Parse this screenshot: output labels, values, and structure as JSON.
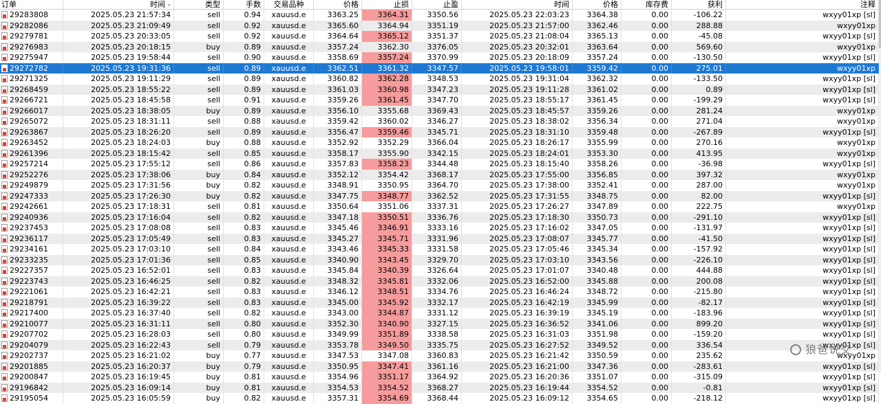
{
  "columns": [
    "订单",
    "时间",
    "类型",
    "手数",
    "交易品种",
    "价格",
    "止损",
    "止盈",
    "时间",
    "价格",
    "库存费",
    "获利",
    "注释"
  ],
  "sort_icon": "sort-desc-icon",
  "colors": {
    "selected_row": "#1e78d2",
    "stop_loss_highlight": "#f69c9c",
    "alt_row": "#ececec"
  },
  "watermark": "狼爸说交",
  "rows": [
    {
      "order": "29283808",
      "open_time": "2025.05.23 21:57:34",
      "type": "sell",
      "volume": "0.94",
      "symbol": "xauusd.e",
      "open_price": "3363.25",
      "sl": "3364.31",
      "tp": "3350.56",
      "close_time": "2025.05.23 22:03:23",
      "close_price": "3364.38",
      "swap": "0.00",
      "profit": "-106.22",
      "comment": "wxyy01xp [sl]",
      "sl_hit": true
    },
    {
      "order": "29282086",
      "open_time": "2025.05.23 21:09:49",
      "type": "sell",
      "volume": "0.92",
      "symbol": "xauusd.e",
      "open_price": "3365.60",
      "sl": "3364.94",
      "tp": "3351.19",
      "close_time": "2025.05.23 21:57:00",
      "close_price": "3362.46",
      "swap": "0.00",
      "profit": "288.88",
      "comment": "wxyy01xp",
      "sl_hit": false
    },
    {
      "order": "29279781",
      "open_time": "2025.05.23 20:33:05",
      "type": "sell",
      "volume": "0.92",
      "symbol": "xauusd.e",
      "open_price": "3364.64",
      "sl": "3365.12",
      "tp": "3351.37",
      "close_time": "2025.05.23 21:08:04",
      "close_price": "3365.13",
      "swap": "0.00",
      "profit": "-45.08",
      "comment": "wxyy01xp [sl]",
      "sl_hit": true
    },
    {
      "order": "29276983",
      "open_time": "2025.05.23 20:18:15",
      "type": "buy",
      "volume": "0.89",
      "symbol": "xauusd.e",
      "open_price": "3357.24",
      "sl": "3362.30",
      "tp": "3376.05",
      "close_time": "2025.05.23 20:32:01",
      "close_price": "3363.64",
      "swap": "0.00",
      "profit": "569.60",
      "comment": "wxyy01xp",
      "sl_hit": false
    },
    {
      "order": "29275947",
      "open_time": "2025.05.23 19:58:44",
      "type": "sell",
      "volume": "0.90",
      "symbol": "xauusd.e",
      "open_price": "3358.69",
      "sl": "3357.24",
      "tp": "3370.99",
      "close_time": "2025.05.23 20:18:09",
      "close_price": "3357.24",
      "swap": "0.00",
      "profit": "-130.50",
      "comment": "wxyy01xp [sl]",
      "sl_hit": true
    },
    {
      "order": "29272782",
      "open_time": "2025.05.23 19:31:36",
      "type": "sell",
      "volume": "0.89",
      "symbol": "xauusd.e",
      "open_price": "3362.51",
      "sl": "3361.32",
      "tp": "3347.57",
      "close_time": "2025.05.23 19:58:01",
      "close_price": "3359.42",
      "swap": "0.00",
      "profit": "275.01",
      "comment": "wxyy01xp",
      "sl_hit": false,
      "selected": true
    },
    {
      "order": "29271325",
      "open_time": "2025.05.23 19:11:29",
      "type": "sell",
      "volume": "0.89",
      "symbol": "xauusd.e",
      "open_price": "3360.82",
      "sl": "3362.28",
      "tp": "3348.53",
      "close_time": "2025.05.23 19:31:04",
      "close_price": "3362.32",
      "swap": "0.00",
      "profit": "-133.50",
      "comment": "wxyy01xp [sl]",
      "sl_hit": true
    },
    {
      "order": "29268459",
      "open_time": "2025.05.23 18:55:22",
      "type": "sell",
      "volume": "0.89",
      "symbol": "xauusd.e",
      "open_price": "3361.03",
      "sl": "3360.98",
      "tp": "3347.23",
      "close_time": "2025.05.23 19:11:28",
      "close_price": "3361.02",
      "swap": "0.00",
      "profit": "0.89",
      "comment": "wxyy01xp [sl]",
      "sl_hit": true
    },
    {
      "order": "29266721",
      "open_time": "2025.05.23 18:45:58",
      "type": "sell",
      "volume": "0.91",
      "symbol": "xauusd.e",
      "open_price": "3359.26",
      "sl": "3361.45",
      "tp": "3347.70",
      "close_time": "2025.05.23 18:55:17",
      "close_price": "3361.45",
      "swap": "0.00",
      "profit": "-199.29",
      "comment": "wxyy01xp [sl]",
      "sl_hit": true
    },
    {
      "order": "29266017",
      "open_time": "2025.05.23 18:38:05",
      "type": "buy",
      "volume": "0.89",
      "symbol": "xauusd.e",
      "open_price": "3356.10",
      "sl": "3355.68",
      "tp": "3369.43",
      "close_time": "2025.05.23 18:45:57",
      "close_price": "3359.26",
      "swap": "0.00",
      "profit": "281.24",
      "comment": "wxyy01xp",
      "sl_hit": false
    },
    {
      "order": "29265072",
      "open_time": "2025.05.23 18:31:11",
      "type": "sell",
      "volume": "0.88",
      "symbol": "xauusd.e",
      "open_price": "3359.42",
      "sl": "3360.02",
      "tp": "3346.27",
      "close_time": "2025.05.23 18:38:02",
      "close_price": "3356.34",
      "swap": "0.00",
      "profit": "271.04",
      "comment": "wxyy01xp",
      "sl_hit": false
    },
    {
      "order": "29263867",
      "open_time": "2025.05.23 18:26:20",
      "type": "sell",
      "volume": "0.89",
      "symbol": "xauusd.e",
      "open_price": "3356.47",
      "sl": "3359.46",
      "tp": "3345.71",
      "close_time": "2025.05.23 18:31:10",
      "close_price": "3359.48",
      "swap": "0.00",
      "profit": "-267.89",
      "comment": "wxyy01xp [sl]",
      "sl_hit": true
    },
    {
      "order": "29263452",
      "open_time": "2025.05.23 18:24:03",
      "type": "buy",
      "volume": "0.88",
      "symbol": "xauusd.e",
      "open_price": "3352.92",
      "sl": "3352.29",
      "tp": "3366.04",
      "close_time": "2025.05.23 18:26:17",
      "close_price": "3355.99",
      "swap": "0.00",
      "profit": "270.16",
      "comment": "wxyy01xp",
      "sl_hit": false
    },
    {
      "order": "29261396",
      "open_time": "2025.05.23 18:15:42",
      "type": "sell",
      "volume": "0.85",
      "symbol": "xauusd.e",
      "open_price": "3358.17",
      "sl": "3355.90",
      "tp": "3342.15",
      "close_time": "2025.05.23 18:24:01",
      "close_price": "3353.30",
      "swap": "0.00",
      "profit": "413.95",
      "comment": "wxyy01xp",
      "sl_hit": false
    },
    {
      "order": "29257214",
      "open_time": "2025.05.23 17:55:12",
      "type": "sell",
      "volume": "0.86",
      "symbol": "xauusd.e",
      "open_price": "3357.83",
      "sl": "3358.23",
      "tp": "3344.48",
      "close_time": "2025.05.23 18:15:40",
      "close_price": "3358.26",
      "swap": "0.00",
      "profit": "-36.98",
      "comment": "wxyy01xp [sl]",
      "sl_hit": true
    },
    {
      "order": "29252276",
      "open_time": "2025.05.23 17:38:06",
      "type": "buy",
      "volume": "0.84",
      "symbol": "xauusd.e",
      "open_price": "3352.12",
      "sl": "3354.42",
      "tp": "3368.17",
      "close_time": "2025.05.23 17:55:00",
      "close_price": "3356.85",
      "swap": "0.00",
      "profit": "397.32",
      "comment": "wxyy01xp",
      "sl_hit": false
    },
    {
      "order": "29249879",
      "open_time": "2025.05.23 17:31:56",
      "type": "buy",
      "volume": "0.82",
      "symbol": "xauusd.e",
      "open_price": "3348.91",
      "sl": "3350.95",
      "tp": "3364.70",
      "close_time": "2025.05.23 17:38:00",
      "close_price": "3352.41",
      "swap": "0.00",
      "profit": "287.00",
      "comment": "wxyy01xp",
      "sl_hit": false
    },
    {
      "order": "29247333",
      "open_time": "2025.05.23 17:26:30",
      "type": "buy",
      "volume": "0.82",
      "symbol": "xauusd.e",
      "open_price": "3347.75",
      "sl": "3348.77",
      "tp": "3362.52",
      "close_time": "2025.05.23 17:31:55",
      "close_price": "3348.75",
      "swap": "0.00",
      "profit": "82.00",
      "comment": "wxyy01xp [sl]",
      "sl_hit": true
    },
    {
      "order": "29242661",
      "open_time": "2025.05.23 17:18:31",
      "type": "sell",
      "volume": "0.81",
      "symbol": "xauusd.e",
      "open_price": "3350.64",
      "sl": "3351.06",
      "tp": "3337.31",
      "close_time": "2025.05.23 17:26:27",
      "close_price": "3347.89",
      "swap": "0.00",
      "profit": "222.75",
      "comment": "wxyy01xp",
      "sl_hit": false
    },
    {
      "order": "29240936",
      "open_time": "2025.05.23 17:16:04",
      "type": "sell",
      "volume": "0.82",
      "symbol": "xauusd.e",
      "open_price": "3347.18",
      "sl": "3350.51",
      "tp": "3336.76",
      "close_time": "2025.05.23 17:18:30",
      "close_price": "3350.73",
      "swap": "0.00",
      "profit": "-291.10",
      "comment": "wxyy01xp [sl]",
      "sl_hit": true
    },
    {
      "order": "29237453",
      "open_time": "2025.05.23 17:08:08",
      "type": "sell",
      "volume": "0.83",
      "symbol": "xauusd.e",
      "open_price": "3345.46",
      "sl": "3346.91",
      "tp": "3333.16",
      "close_time": "2025.05.23 17:16:02",
      "close_price": "3347.05",
      "swap": "0.00",
      "profit": "-131.97",
      "comment": "wxyy01xp [sl]",
      "sl_hit": true
    },
    {
      "order": "29236117",
      "open_time": "2025.05.23 17:05:49",
      "type": "sell",
      "volume": "0.83",
      "symbol": "xauusd.e",
      "open_price": "3345.27",
      "sl": "3345.71",
      "tp": "3331.96",
      "close_time": "2025.05.23 17:08:07",
      "close_price": "3345.77",
      "swap": "0.00",
      "profit": "-41.50",
      "comment": "wxyy01xp [sl]",
      "sl_hit": true
    },
    {
      "order": "29234161",
      "open_time": "2025.05.23 17:03:10",
      "type": "sell",
      "volume": "0.84",
      "symbol": "xauusd.e",
      "open_price": "3343.46",
      "sl": "3345.33",
      "tp": "3331.58",
      "close_time": "2025.05.23 17:05:46",
      "close_price": "3345.34",
      "swap": "0.00",
      "profit": "-157.92",
      "comment": "wxyy01xp [sl]",
      "sl_hit": true
    },
    {
      "order": "29233235",
      "open_time": "2025.05.23 17:01:36",
      "type": "sell",
      "volume": "0.85",
      "symbol": "xauusd.e",
      "open_price": "3340.90",
      "sl": "3343.45",
      "tp": "3329.70",
      "close_time": "2025.05.23 17:03:10",
      "close_price": "3343.56",
      "swap": "0.00",
      "profit": "-226.10",
      "comment": "wxyy01xp [sl]",
      "sl_hit": true
    },
    {
      "order": "29227357",
      "open_time": "2025.05.23 16:52:01",
      "type": "sell",
      "volume": "0.83",
      "symbol": "xauusd.e",
      "open_price": "3345.84",
      "sl": "3340.39",
      "tp": "3326.64",
      "close_time": "2025.05.23 17:01:07",
      "close_price": "3340.48",
      "swap": "0.00",
      "profit": "444.88",
      "comment": "wxyy01xp [sl]",
      "sl_hit": true
    },
    {
      "order": "29223743",
      "open_time": "2025.05.23 16:46:25",
      "type": "sell",
      "volume": "0.82",
      "symbol": "xauusd.e",
      "open_price": "3348.32",
      "sl": "3345.81",
      "tp": "3332.06",
      "close_time": "2025.05.23 16:52:00",
      "close_price": "3345.88",
      "swap": "0.00",
      "profit": "200.08",
      "comment": "wxyy01xp [sl]",
      "sl_hit": true
    },
    {
      "order": "29221061",
      "open_time": "2025.05.23 16:42:21",
      "type": "sell",
      "volume": "0.83",
      "symbol": "xauusd.e",
      "open_price": "3346.12",
      "sl": "3348.51",
      "tp": "3334.76",
      "close_time": "2025.05.23 16:46:24",
      "close_price": "3348.72",
      "swap": "0.00",
      "profit": "-215.80",
      "comment": "wxyy01xp [sl]",
      "sl_hit": true
    },
    {
      "order": "29218791",
      "open_time": "2025.05.23 16:39:22",
      "type": "sell",
      "volume": "0.83",
      "symbol": "xauusd.e",
      "open_price": "3345.00",
      "sl": "3345.92",
      "tp": "3332.17",
      "close_time": "2025.05.23 16:42:19",
      "close_price": "3345.99",
      "swap": "0.00",
      "profit": "-82.17",
      "comment": "wxyy01xp [sl]",
      "sl_hit": true
    },
    {
      "order": "29217400",
      "open_time": "2025.05.23 16:37:40",
      "type": "sell",
      "volume": "0.82",
      "symbol": "xauusd.e",
      "open_price": "3343.00",
      "sl": "3344.87",
      "tp": "3331.12",
      "close_time": "2025.05.23 16:39:19",
      "close_price": "3345.19",
      "swap": "0.00",
      "profit": "-183.96",
      "comment": "wxyy01xp [sl]",
      "sl_hit": true
    },
    {
      "order": "29210077",
      "open_time": "2025.05.23 16:31:11",
      "type": "sell",
      "volume": "0.80",
      "symbol": "xauusd.e",
      "open_price": "3352.30",
      "sl": "3340.90",
      "tp": "3327.15",
      "close_time": "2025.05.23 16:36:52",
      "close_price": "3341.06",
      "swap": "0.00",
      "profit": "899.20",
      "comment": "wxyy01xp [sl]",
      "sl_hit": true
    },
    {
      "order": "29207702",
      "open_time": "2025.05.23 16:28:03",
      "type": "sell",
      "volume": "0.80",
      "symbol": "xauusd.e",
      "open_price": "3349.99",
      "sl": "3351.89",
      "tp": "3338.58",
      "close_time": "2025.05.23 16:31:03",
      "close_price": "3351.98",
      "swap": "0.00",
      "profit": "-159.20",
      "comment": "wxyy01xp [sl]",
      "sl_hit": true
    },
    {
      "order": "29204079",
      "open_time": "2025.05.23 16:22:43",
      "type": "sell",
      "volume": "0.79",
      "symbol": "xauusd.e",
      "open_price": "3353.78",
      "sl": "3349.50",
      "tp": "3335.75",
      "close_time": "2025.05.23 16:27:52",
      "close_price": "3349.52",
      "swap": "0.00",
      "profit": "336.54",
      "comment": "wxyy01xp [sl]",
      "sl_hit": true
    },
    {
      "order": "29202737",
      "open_time": "2025.05.23 16:21:02",
      "type": "buy",
      "volume": "0.77",
      "symbol": "xauusd.e",
      "open_price": "3347.53",
      "sl": "3347.08",
      "tp": "3360.83",
      "close_time": "2025.05.23 16:21:42",
      "close_price": "3350.59",
      "swap": "0.00",
      "profit": "235.62",
      "comment": "wxyy01xp",
      "sl_hit": false
    },
    {
      "order": "29201885",
      "open_time": "2025.05.23 16:20:37",
      "type": "buy",
      "volume": "0.79",
      "symbol": "xauusd.e",
      "open_price": "3350.95",
      "sl": "3347.41",
      "tp": "3361.16",
      "close_time": "2025.05.23 16:21:00",
      "close_price": "3347.36",
      "swap": "0.00",
      "profit": "-283.61",
      "comment": "wxyy01xp [sl]",
      "sl_hit": true
    },
    {
      "order": "29200847",
      "open_time": "2025.05.23 16:19:45",
      "type": "buy",
      "volume": "0.81",
      "symbol": "xauusd.e",
      "open_price": "3354.96",
      "sl": "3351.17",
      "tp": "3364.92",
      "close_time": "2025.05.23 16:20:36",
      "close_price": "3351.07",
      "swap": "0.00",
      "profit": "-315.09",
      "comment": "wxyy01xp [sl]",
      "sl_hit": true
    },
    {
      "order": "29196842",
      "open_time": "2025.05.23 16:09:14",
      "type": "buy",
      "volume": "0.81",
      "symbol": "xauusd.e",
      "open_price": "3354.53",
      "sl": "3354.52",
      "tp": "3368.27",
      "close_time": "2025.05.23 16:19:44",
      "close_price": "3354.52",
      "swap": "0.00",
      "profit": "-0.81",
      "comment": "wxyy01xp [sl]",
      "sl_hit": true
    },
    {
      "order": "29195054",
      "open_time": "2025.05.23 16:05:59",
      "type": "buy",
      "volume": "0.82",
      "symbol": "xauusd.e",
      "open_price": "3357.31",
      "sl": "3354.69",
      "tp": "3368.44",
      "close_time": "2025.05.23 16:09:12",
      "close_price": "3354.65",
      "swap": "0.00",
      "profit": "-218.12",
      "comment": "wxyy01xp [sl]",
      "sl_hit": true
    }
  ]
}
